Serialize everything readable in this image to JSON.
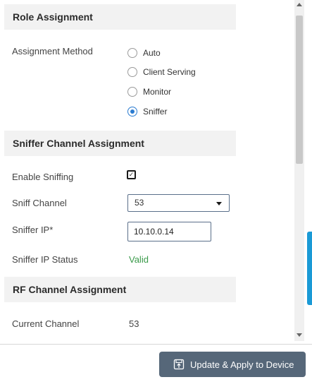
{
  "role_assignment": {
    "title": "Role Assignment",
    "method_label": "Assignment Method",
    "options": [
      "Auto",
      "Client Serving",
      "Monitor",
      "Sniffer"
    ],
    "selected": "Sniffer"
  },
  "sniffer_channel": {
    "title": "Sniffer Channel Assignment",
    "enable_label": "Enable Sniffing",
    "enable_checked": true,
    "enable_check_glyph": "✓",
    "channel_label": "Sniff Channel",
    "channel_value": "53",
    "ip_label": "Sniffer IP*",
    "ip_value": "10.10.0.14",
    "status_label": "Sniffer IP Status",
    "status_value": "Valid"
  },
  "rf_channel": {
    "title": "RF Channel Assignment",
    "current_label": "Current Channel",
    "current_value": "53"
  },
  "footer": {
    "apply_label": "Update & Apply to Device",
    "apply_icon": "save-upload-icon"
  },
  "colors": {
    "accent": "#2a7bd0",
    "valid": "#3a9a4a",
    "button": "#566779",
    "side_tab": "#1a9ad6"
  }
}
